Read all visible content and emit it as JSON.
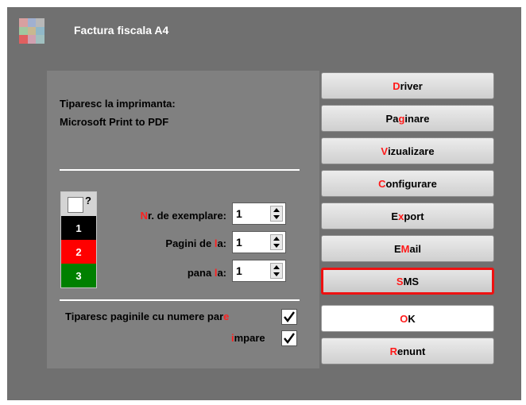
{
  "window": {
    "title": "Factura fiscala A4"
  },
  "printer": {
    "label": "Tiparesc la imprimanta:",
    "name": "Microsoft Print to PDF"
  },
  "colors": {
    "black": "#000000",
    "red": "#ff0000",
    "green": "#008000",
    "hotkey": "#ff1a1a"
  },
  "colorbox": {
    "question": "?",
    "opt1": "1",
    "opt2": "2",
    "opt3": "3"
  },
  "fields": {
    "copies": {
      "hot": "N",
      "rest": "r. de exemplare:",
      "value": "1"
    },
    "from": {
      "pre": "Pagini de ",
      "hot": "l",
      "post": "a:",
      "value": "1"
    },
    "to": {
      "pre": "pana ",
      "hot": "l",
      "post": "a:",
      "value": "1"
    }
  },
  "even_pages": {
    "pre": "Tiparesc paginile cu numere par",
    "hot": "e",
    "checked": true
  },
  "odd_pages": {
    "hot": "i",
    "rest": "mpare",
    "checked": true
  },
  "buttons": [
    {
      "hot": "D",
      "rest": "river"
    },
    {
      "pre": "Pa",
      "hot": "g",
      "rest": "inare"
    },
    {
      "hot": "V",
      "rest": "izualizare"
    },
    {
      "hot": "C",
      "rest": "onfigurare"
    },
    {
      "pre": "E",
      "hot": "x",
      "rest": "port"
    },
    {
      "pre": "E",
      "hot": "M",
      "rest": "ail"
    },
    {
      "hot": "S",
      "rest": "MS"
    },
    {
      "hot": "O",
      "rest": "K"
    },
    {
      "hot": "R",
      "rest": "enunt"
    }
  ]
}
